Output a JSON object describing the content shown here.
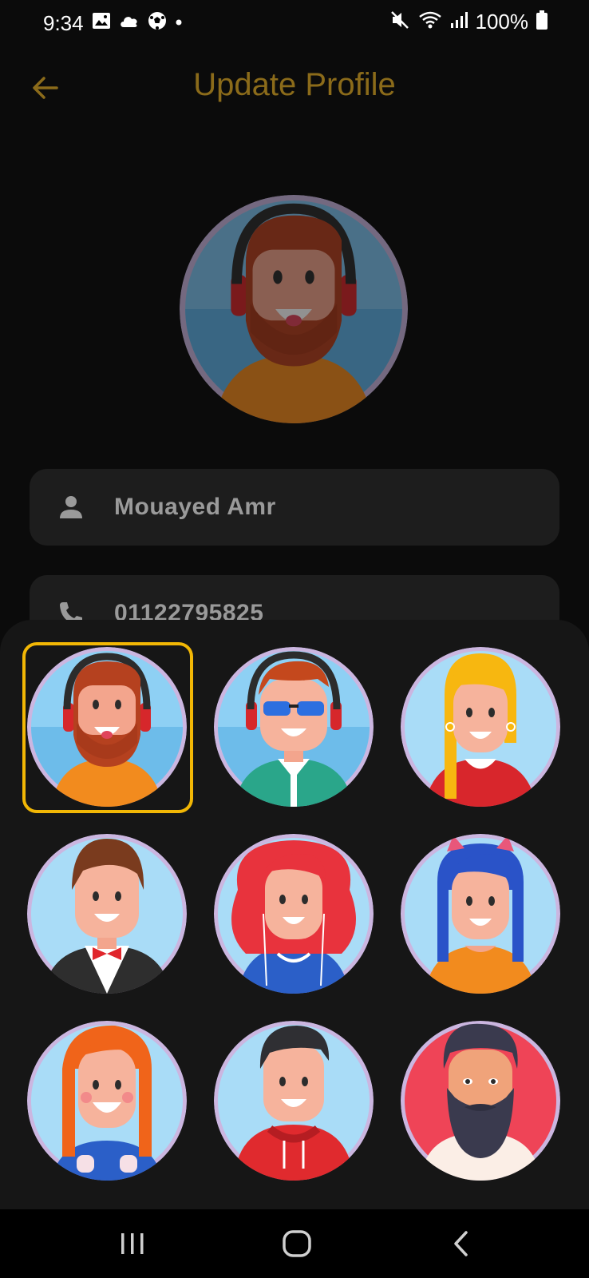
{
  "status_bar": {
    "time": "9:34",
    "left_icons": [
      "image-icon",
      "cloud-icon",
      "soccer-ball-icon",
      "dot-icon"
    ],
    "right_icons": [
      "mute-icon",
      "wifi-icon",
      "signal-icon"
    ],
    "battery_percent": "100%"
  },
  "header": {
    "title": "Update Profile",
    "back_icon": "arrow-left-icon",
    "accent_color": "#8b6b1a"
  },
  "profile": {
    "current_avatar": "bearded-man-headphones"
  },
  "fields": [
    {
      "icon": "person-icon",
      "value": "Mouayed Amr"
    },
    {
      "icon": "phone-icon",
      "value": "01122795825"
    }
  ],
  "avatar_picker": {
    "selected_index": 0,
    "selection_color": "#f2b705",
    "avatars": [
      "bearded-man-headphones",
      "man-headphones-sunglasses",
      "blonde-woman",
      "man-bow-tie",
      "red-haired-woman-earbuds",
      "blue-haired-woman-cat-ears",
      "orange-haired-woman",
      "man-red-hoodie",
      "bearded-man-red-background"
    ]
  },
  "nav_bar": {
    "buttons": [
      "recents-icon",
      "home-icon",
      "back-icon"
    ]
  }
}
